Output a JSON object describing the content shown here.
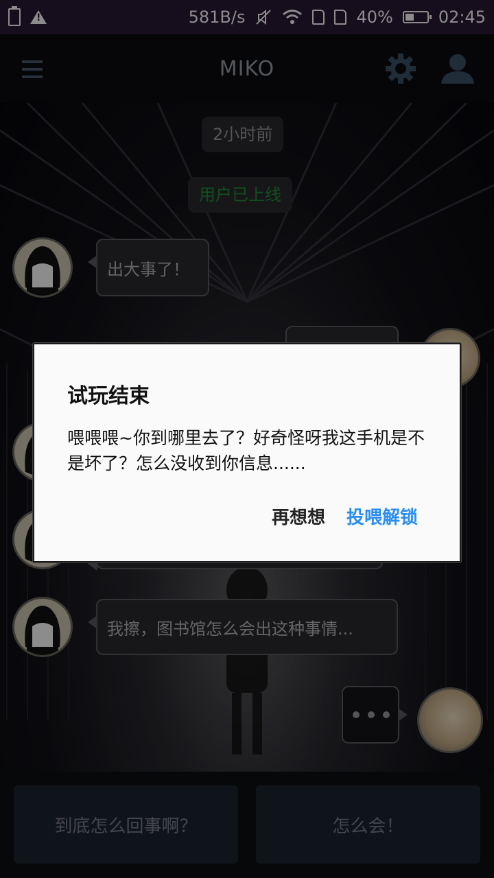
{
  "status_bar": {
    "net_speed": "581B/s",
    "battery_percent": "40%",
    "battery_level": 0.4,
    "time": "02:45"
  },
  "app_bar": {
    "title": "MIKO",
    "icons": [
      "menu-icon",
      "gear-icon",
      "person-icon"
    ]
  },
  "chat": {
    "time_label": "2小时前",
    "online_label": "用户已上线",
    "online_color": "#1f8f3a",
    "messages": [
      {
        "from": "peer",
        "text": "出大事了！"
      },
      {
        "from": "peer",
        "text": "我擦，图书馆怎么会出这种事情..."
      }
    ]
  },
  "quick_replies": {
    "left": "到底怎么回事啊？",
    "right": "怎么会！"
  },
  "dialog": {
    "title": "试玩结束",
    "message": "喂喂喂~你到哪里去了？好奇怪呀我这手机是不是坏了？怎么没收到你信息......",
    "cancel_label": "再想想",
    "confirm_label": "投喂解锁",
    "confirm_color": "#2a8ef0"
  }
}
